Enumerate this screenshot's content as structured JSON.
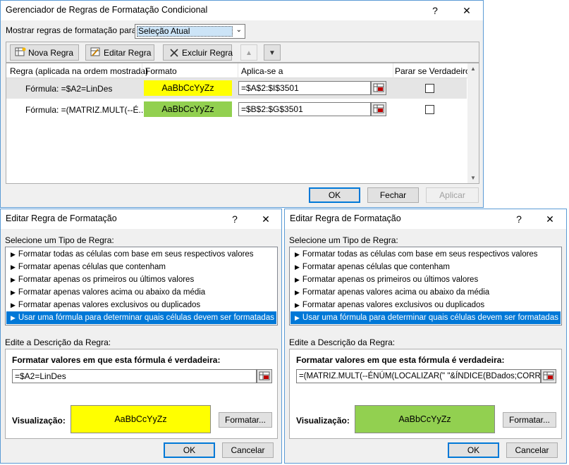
{
  "manager": {
    "title": "Gerenciador de Regras de Formatação Condicional",
    "help": "?",
    "close": "✕",
    "show_rules_label": "Mostrar regras de formatação para:",
    "show_rules_value": "Seleção Atual",
    "toolbar": {
      "new_rule": "Nova Regra",
      "edit_rule": "Editar Regra",
      "delete_rule": "Excluir Regra"
    },
    "columns": [
      "Regra (aplicada na ordem mostrada)",
      "Formato",
      "Aplica-se a",
      "Parar se Verdadeiro"
    ],
    "rules": [
      {
        "rule": "Fórmula: =$A2=LinDes",
        "format_preview": "AaBbCcYyZz",
        "format_color": "#ffff00",
        "applies_to": "=$A$2:$I$3501",
        "stop_if_true": false
      },
      {
        "rule": "Fórmula: =(MATRIZ.MULT(--É...",
        "format_preview": "AaBbCcYyZz",
        "format_color": "#92d050",
        "applies_to": "=$B$2:$G$3501",
        "stop_if_true": false
      }
    ],
    "ok": "OK",
    "close_btn": "Fechar",
    "apply": "Aplicar"
  },
  "edit_left": {
    "title": "Editar Regra de Formatação",
    "help": "?",
    "close": "✕",
    "rule_type_label": "Selecione um Tipo de Regra:",
    "rule_types": [
      "Formatar todas as células com base em seus respectivos valores",
      "Formatar apenas células que contenham",
      "Formatar apenas os primeiros ou últimos valores",
      "Formatar apenas valores acima ou abaixo da média",
      "Formatar apenas valores exclusivos ou duplicados",
      "Usar uma fórmula para determinar quais células devem ser formatadas"
    ],
    "selected_index": 5,
    "description_label": "Edite a Descrição da Regra:",
    "formula_label": "Formatar valores em que esta fórmula é verdadeira:",
    "formula": "=$A2=LinDes",
    "preview_label": "Visualização:",
    "preview_text": "AaBbCcYyZz",
    "preview_color": "#ffff00",
    "format_button": "Formatar...",
    "ok": "OK",
    "cancel": "Cancelar"
  },
  "edit_right": {
    "title": "Editar Regra de Formatação",
    "help": "?",
    "close": "✕",
    "rule_type_label": "Selecione um Tipo de Regra:",
    "rule_types": [
      "Formatar todas as células com base em seus respectivos valores",
      "Formatar apenas células que contenham",
      "Formatar apenas os primeiros ou últimos valores",
      "Formatar apenas valores acima ou abaixo da média",
      "Formatar apenas valores exclusivos ou duplicados",
      "Usar uma fórmula para determinar quais células devem ser formatadas"
    ],
    "selected_index": 5,
    "description_label": "Edite a Descrição da Regra:",
    "formula_label": "Formatar valores em que esta fórmula é verdadeira:",
    "formula": "=(MATRIZ.MULT(--ÉNÚM(LOCALIZAR(\" \"&ÍNDICE(BDados;CORRESP(Li",
    "preview_label": "Visualização:",
    "preview_text": "AaBbCcYyZz",
    "preview_color": "#92d050",
    "format_button": "Formatar...",
    "ok": "OK",
    "cancel": "Cancelar"
  }
}
